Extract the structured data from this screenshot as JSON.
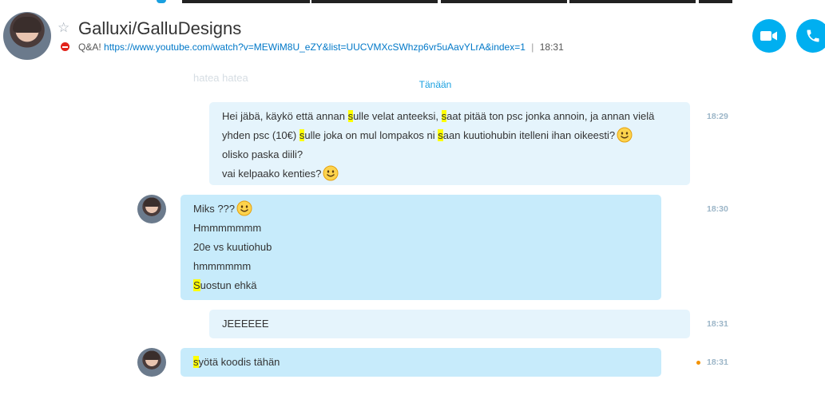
{
  "header": {
    "contact_name": "Galluxi/GalluDesigns",
    "mood_prefix": "Q&A!",
    "mood_link": "https://www.youtube.com/watch?v=MEWiM8U_eZY&list=UUCVMXcSWhzp6vr5uAavYLrA&index=1",
    "mood_separator": "|",
    "mood_time": "18:31",
    "status": "do-not-disturb",
    "video_call_icon": "video-camera-icon",
    "audio_call_icon": "phone-icon"
  },
  "faded_message": "hatea hatea",
  "date_divider": "Tänään",
  "messages": [
    {
      "direction": "outgoing",
      "time": "18:29",
      "lines": [
        {
          "parts": [
            "Hei jäbä, käykö että annan ",
            "s",
            "ulle velat anteeksi, ",
            "s",
            "aat pitää ton psc jonka annoin, ja annan vielä"
          ]
        },
        {
          "parts": [
            "yhden psc (10€) ",
            "s",
            "ulle joka on mul lompakos ni ",
            "s",
            "aan kuutiohubin itelleni ihan oikeesti?"
          ]
        },
        {
          "parts": [
            "olisko paska diili?"
          ]
        },
        {
          "parts": [
            "vai kelpaako kenties?"
          ]
        }
      ]
    },
    {
      "direction": "incoming",
      "time": "18:30",
      "lines": [
        "Miks ???",
        "Hmmmmmmm",
        "20e vs kuutiohub",
        "hmmmmmm",
        "S",
        "uostun ehkä"
      ]
    },
    {
      "direction": "outgoing",
      "time": "18:31",
      "lines": [
        "JEEEEEE"
      ]
    },
    {
      "direction": "incoming",
      "time": "18:31",
      "lines": [
        "s",
        "yötä koodis tähän"
      ],
      "unread_indicator": true
    }
  ],
  "colors": {
    "accent": "#00aff0",
    "bubble_out": "#e5f4fc",
    "bubble_in": "#c7ebfb",
    "highlight": "#ffff00",
    "dnd": "#e2231a"
  }
}
